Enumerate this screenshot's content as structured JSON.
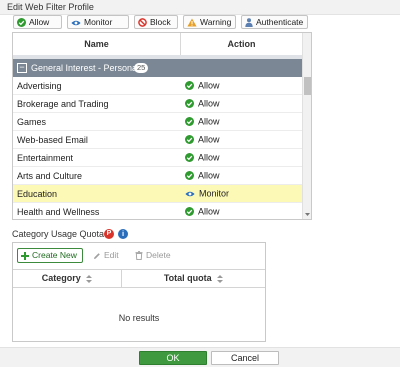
{
  "window": {
    "title": "Edit Web Filter Profile"
  },
  "action_toolbar": {
    "buttons": [
      {
        "label": "Allow",
        "icon": "check-circle-icon"
      },
      {
        "label": "Monitor",
        "icon": "eye-icon"
      },
      {
        "label": "Block",
        "icon": "block-icon"
      },
      {
        "label": "Warning",
        "icon": "warning-icon"
      },
      {
        "label": "Authenticate",
        "icon": "user-icon"
      }
    ]
  },
  "category_table": {
    "columns": [
      "Name",
      "Action"
    ],
    "group": {
      "label": "General Interest - Personal",
      "count": "25"
    },
    "rows": [
      {
        "name": "Advertising",
        "action": "Allow"
      },
      {
        "name": "Brokerage and Trading",
        "action": "Allow"
      },
      {
        "name": "Games",
        "action": "Allow"
      },
      {
        "name": "Web-based Email",
        "action": "Allow"
      },
      {
        "name": "Entertainment",
        "action": "Allow"
      },
      {
        "name": "Arts and Culture",
        "action": "Allow"
      },
      {
        "name": "Education",
        "action": "Monitor",
        "highlighted": true
      },
      {
        "name": "Health and Wellness",
        "action": "Allow"
      }
    ]
  },
  "quota": {
    "label": "Category Usage Quota",
    "badge_p": "P",
    "badge_i": "i",
    "toolbar": {
      "create_label": "Create New",
      "edit_label": "Edit",
      "delete_label": "Delete"
    },
    "columns": [
      "Category",
      "Total quota"
    ],
    "empty_text": "No results"
  },
  "footer": {
    "ok_label": "OK",
    "cancel_label": "Cancel"
  },
  "colors": {
    "allow": "#2f9a2f",
    "monitor": "#2a6ebb",
    "block": "#d9342b",
    "warning": "#e6a02a",
    "group_header": "#7b8794",
    "highlight_row": "#fcf8b5",
    "ok_button": "#3f9a3f"
  }
}
